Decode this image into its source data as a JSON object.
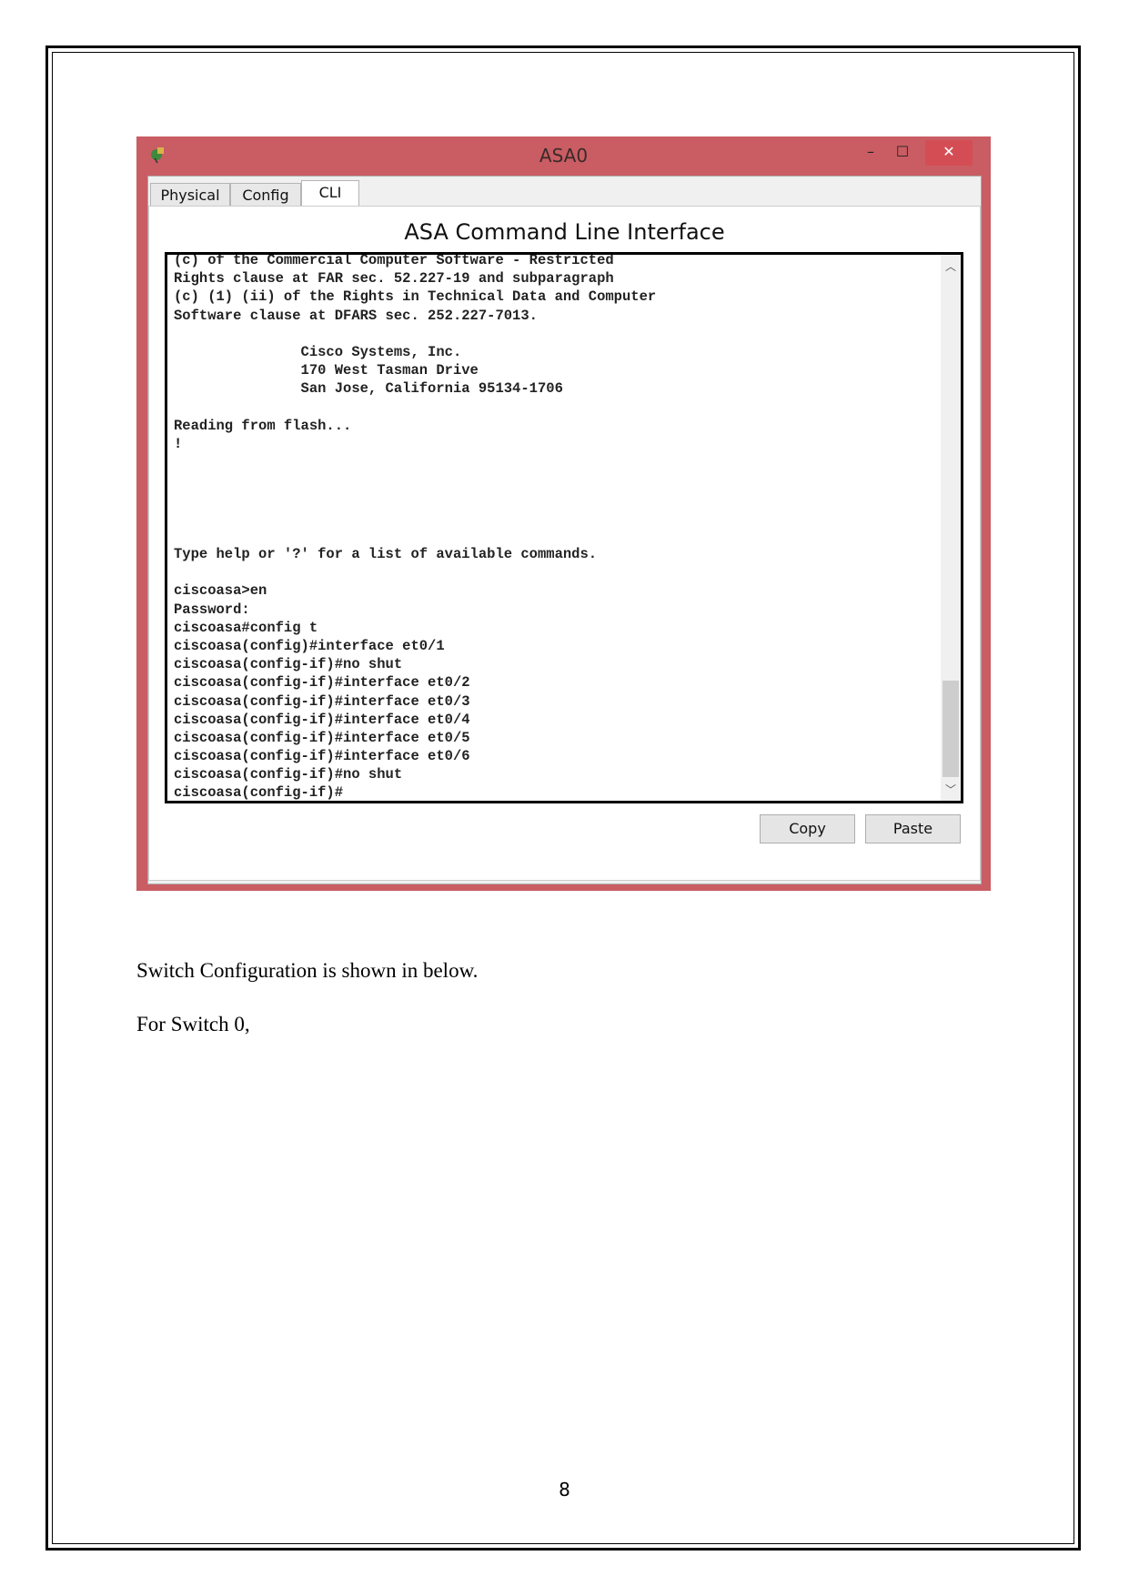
{
  "window": {
    "title": "ASA0",
    "accent_color": "#c95d63",
    "controls": {
      "minimize": "–",
      "maximize": "☐",
      "close": "✕"
    },
    "tabs": [
      {
        "label": "Physical"
      },
      {
        "label": "Config"
      },
      {
        "label": "CLI"
      }
    ],
    "active_tab": "CLI",
    "panel_title": "ASA Command Line Interface",
    "terminal_lines": [
      "(c) of the Commercial Computer Software - Restricted",
      "Rights clause at FAR sec. 52.227-19 and subparagraph",
      "(c) (1) (ii) of the Rights in Technical Data and Computer",
      "Software clause at DFARS sec. 252.227-7013.",
      "",
      "               Cisco Systems, Inc.",
      "               170 West Tasman Drive",
      "               San Jose, California 95134-1706",
      "",
      "Reading from flash...",
      "!",
      "",
      "",
      "",
      "",
      "",
      "Type help or '?' for a list of available commands.",
      "",
      "ciscoasa>en",
      "Password:",
      "ciscoasa#config t",
      "ciscoasa(config)#interface et0/1",
      "ciscoasa(config-if)#no shut",
      "ciscoasa(config-if)#interface et0/2",
      "ciscoasa(config-if)#interface et0/3",
      "ciscoasa(config-if)#interface et0/4",
      "ciscoasa(config-if)#interface et0/5",
      "ciscoasa(config-if)#interface et0/6",
      "ciscoasa(config-if)#no shut",
      "ciscoasa(config-if)#"
    ],
    "copy_label": "Copy",
    "paste_label": "Paste"
  },
  "document": {
    "paragraphs": [
      "Switch Configuration is shown in below.",
      "For Switch 0,"
    ],
    "page_number": "8"
  }
}
